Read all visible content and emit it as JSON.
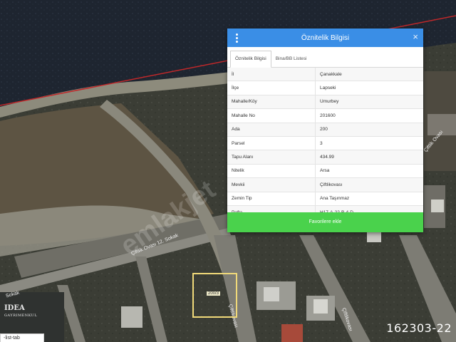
{
  "panel": {
    "title": "Öznitelik Bilgisi",
    "close_glyph": "×",
    "menu_icon": "vertical-dots-icon",
    "tabs": [
      {
        "label": "Öznitelik Bilgisi",
        "active": true
      },
      {
        "label": "Bina/BB Listesi",
        "active": false
      }
    ],
    "rows": [
      {
        "key": "İl",
        "value": "Çanakkale"
      },
      {
        "key": "İlçe",
        "value": "Lapseki"
      },
      {
        "key": "Mahalle/Köy",
        "value": "Umurbey"
      },
      {
        "key": "Mahalle No",
        "value": "201600"
      },
      {
        "key": "Ada",
        "value": "200"
      },
      {
        "key": "Parsel",
        "value": "3"
      },
      {
        "key": "Tapu Alanı",
        "value": "434.99"
      },
      {
        "key": "Nitelik",
        "value": "Arsa"
      },
      {
        "key": "Mevkii",
        "value": "Çiftlikovası"
      },
      {
        "key": "Zemin Tip",
        "value": "Ana Taşınmaz"
      },
      {
        "key": "Pafta",
        "value": "H17-A-22-B-4-D"
      }
    ],
    "favorite_button": "Favorilere ekle",
    "header_color": "#3a8ee6",
    "button_color": "#4ad24c"
  },
  "map": {
    "parcel_label": "200/3",
    "streets": {
      "main": "Çiftlik Ovası 12. Sokak",
      "vertical": "Çiftlikovası",
      "vertical2": "Çiftlikovası",
      "right": "Çiftlik Ovası",
      "left": "Sokak"
    },
    "watermark": "emlakjet",
    "listing_id": "162303-22",
    "logo_main": "IDEA",
    "logo_sub": "GAYRIMENKUL",
    "list_tab": "-list-tab"
  }
}
